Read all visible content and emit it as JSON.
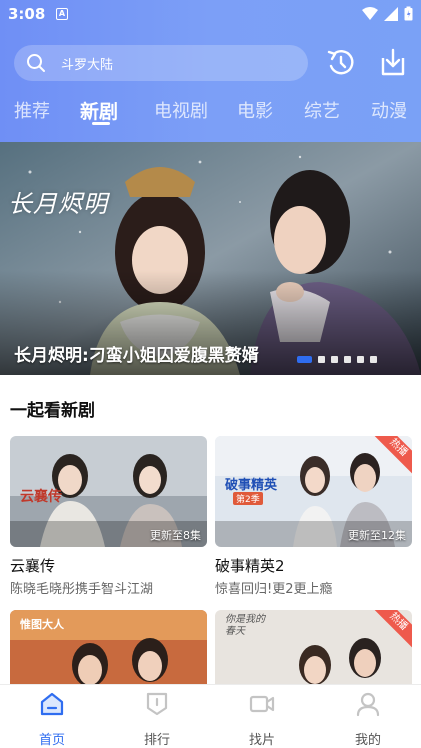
{
  "status_bar": {
    "time": "3:08",
    "notification_icon": "A"
  },
  "search": {
    "placeholder": "斗罗大陆"
  },
  "header_buttons": [
    "history-icon",
    "download-icon"
  ],
  "tabs": [
    {
      "label": "推荐",
      "active": false
    },
    {
      "label": "新剧",
      "active": true
    },
    {
      "label": "电视剧",
      "active": false
    },
    {
      "label": "电影",
      "active": false
    },
    {
      "label": "综艺",
      "active": false
    },
    {
      "label": "动漫",
      "active": false
    }
  ],
  "banner": {
    "caption": "长月烬明:刁蛮小姐囚爱腹黑赘婿",
    "logo_text": "长月烬明",
    "slide_count": 6,
    "active_slide": 1
  },
  "section": {
    "title": "一起看新剧"
  },
  "cards": [
    {
      "title": "云襄传",
      "subtitle": "陈晓毛晓彤携手智斗江湖",
      "badge": "更新至8集",
      "hot": false,
      "poster_text": "云襄传"
    },
    {
      "title": "破事精英2",
      "subtitle": "惊喜回归!更2更上瘾",
      "badge": "更新至12集",
      "hot": true,
      "hot_label": "热播",
      "poster_text": "破事精英",
      "poster_sub": "第2季"
    },
    {
      "title": "",
      "subtitle": "",
      "badge": "",
      "hot": false,
      "poster_text": "惟图大人"
    },
    {
      "title": "",
      "subtitle": "",
      "badge": "",
      "hot": true,
      "hot_label": "热播",
      "poster_text": "你是我的春天"
    }
  ],
  "bottom_nav": [
    {
      "label": "首页",
      "icon": "home-icon",
      "active": true
    },
    {
      "label": "排行",
      "icon": "rank-icon",
      "active": false
    },
    {
      "label": "找片",
      "icon": "video-icon",
      "active": false
    },
    {
      "label": "我的",
      "icon": "user-icon",
      "active": false
    }
  ],
  "colors": {
    "accent": "#2f6df0",
    "header_start": "#6f8ff5",
    "header_end": "#7aa1f6",
    "hot_badge": "#ee5a4c"
  }
}
